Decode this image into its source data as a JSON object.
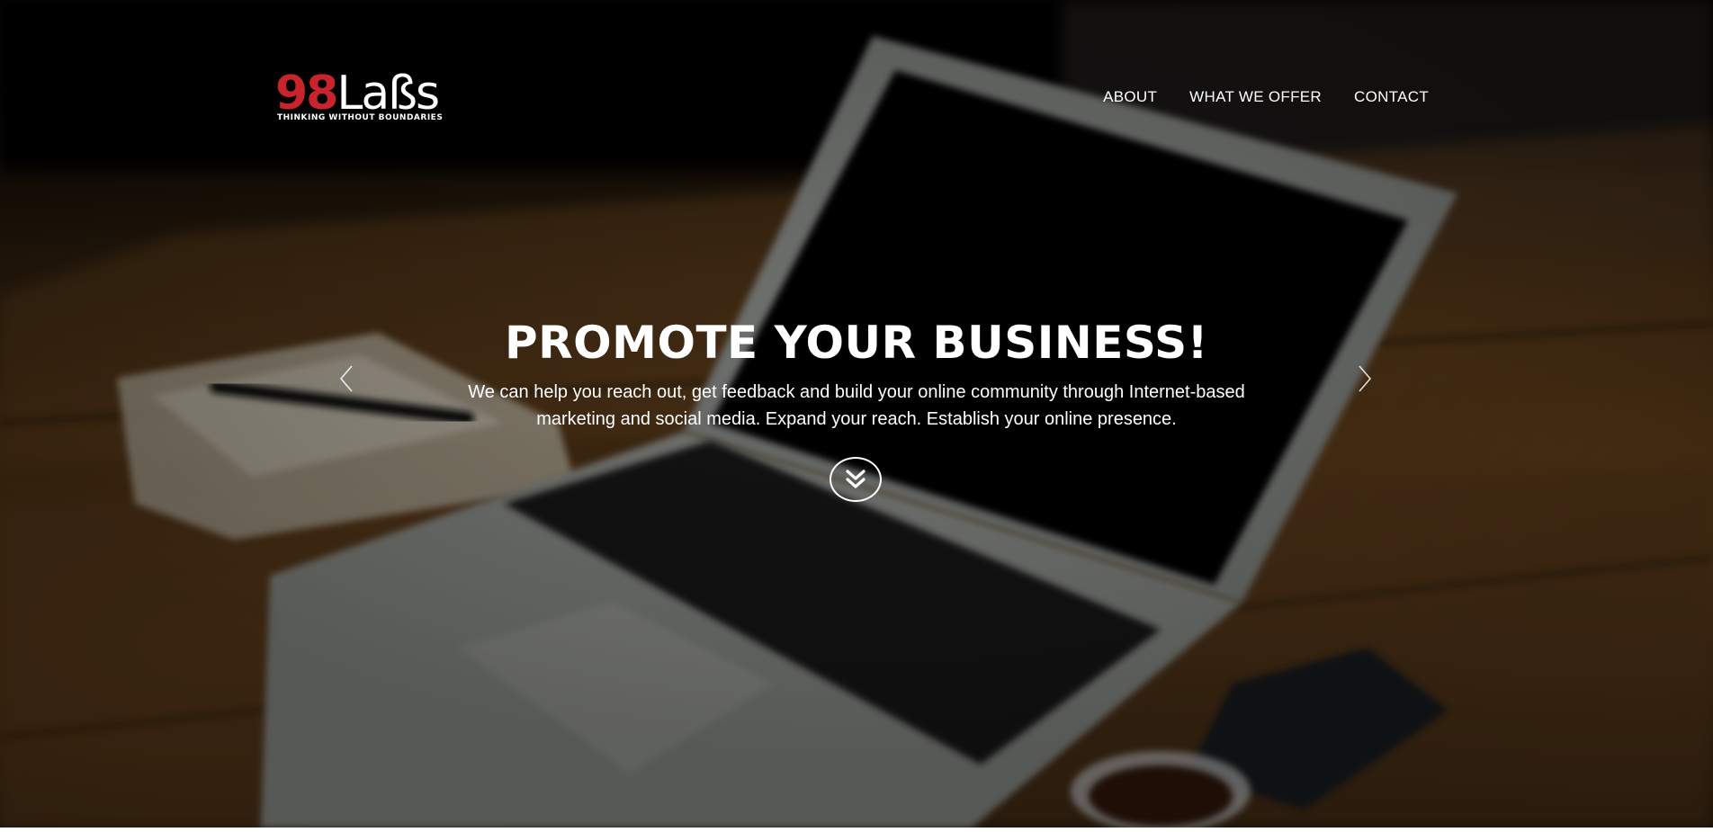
{
  "brand": {
    "logo_number": "98",
    "logo_word": "Laßs",
    "tagline": "THINKING WITHOUT BOUNDARIES",
    "number_color": "#c9242b"
  },
  "nav": {
    "items": [
      {
        "label": "ABOUT"
      },
      {
        "label": "WHAT WE OFFER"
      },
      {
        "label": "CONTACT"
      }
    ]
  },
  "hero": {
    "title": "PROMOTE YOUR BUSINESS!",
    "description": "We can help you reach out, get feedback and build your online community through Internet-based marketing and social media. Expand your reach. Establish your online presence.",
    "scroll_icon": "double-chevron-down-icon",
    "prev_icon": "chevron-left-icon",
    "next_icon": "chevron-right-icon"
  }
}
